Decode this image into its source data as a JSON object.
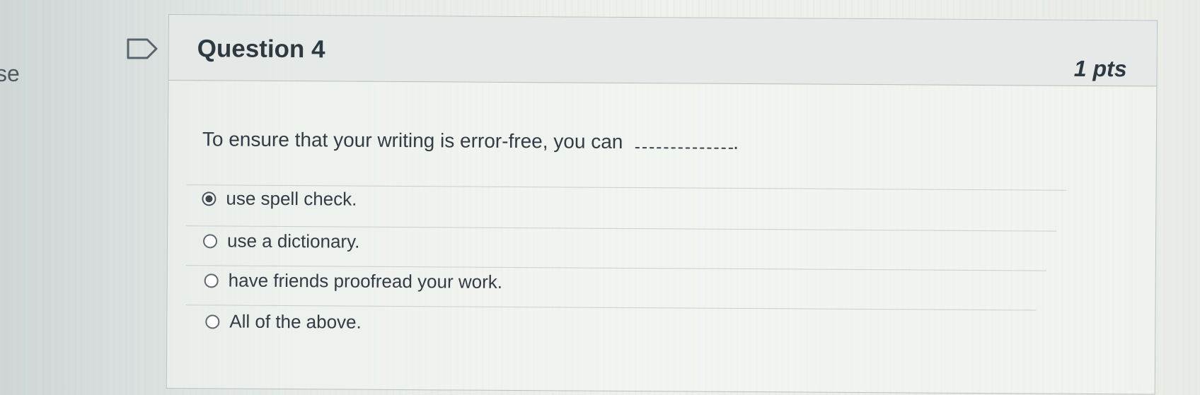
{
  "sidebar": {
    "edge_text": "se"
  },
  "question": {
    "title": "Question 4",
    "points": "1 pts",
    "prompt": "To ensure that your writing is error-free, you can",
    "prompt_end": ".",
    "answers": [
      {
        "label": "use spell check.",
        "selected": true
      },
      {
        "label": "use a dictionary.",
        "selected": false
      },
      {
        "label": "have friends proofread your work.",
        "selected": false
      },
      {
        "label": "All of the above.",
        "selected": false
      }
    ]
  }
}
